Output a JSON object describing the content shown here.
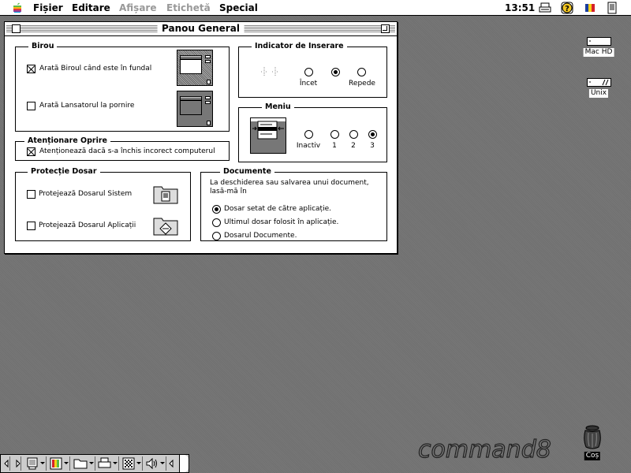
{
  "menubar": {
    "apple_icon": "apple-logo-icon",
    "items": [
      {
        "label": "Fișier",
        "enabled": true
      },
      {
        "label": "Editare",
        "enabled": true
      },
      {
        "label": "Afișare",
        "enabled": false
      },
      {
        "label": "Etichetă",
        "enabled": false
      },
      {
        "label": "Special",
        "enabled": true
      }
    ],
    "clock": "13:51",
    "status_icons": [
      "printer-icon",
      "help-icon",
      "keyboard-flag-icon",
      "application-menu-icon"
    ]
  },
  "window": {
    "title": "Panou General",
    "desktop_group": {
      "title": "Birou",
      "show_desktop_label": "Arată Biroul când este în fundal",
      "show_desktop_checked": true,
      "show_launcher_label": "Arată Lansatorul la pornire",
      "show_launcher_checked": false
    },
    "shutdown_group": {
      "title": "Atenționare Oprire",
      "warn_label": "Atenționează dacă s-a închis incorect computerul",
      "warn_checked": true
    },
    "folder_protection_group": {
      "title": "Protecție Dosar",
      "system_label": "Protejează Dosarul Sistem",
      "system_checked": false,
      "apps_label": "Protejează Dosarul Aplicații",
      "apps_checked": false
    },
    "insertion_group": {
      "title": "Indicator de Inserare",
      "options": [
        "Încet",
        "",
        "Repede"
      ],
      "selected_index": 1
    },
    "menu_group": {
      "title": "Meniu",
      "options": [
        "Inactiv",
        "1",
        "2",
        "3"
      ],
      "selected_index": 3
    },
    "documents_group": {
      "title": "Documente",
      "description": "La deschiderea sau salvarea unui document, lasă-mă în",
      "options": [
        "Dosar setat de către aplicație.",
        "Ultimul dosar folosit în aplicație.",
        "Dosarul Documente."
      ],
      "selected_index": 0
    }
  },
  "desktop": {
    "icons": [
      {
        "label": "Mac HD",
        "icon": "hard-disk-icon"
      },
      {
        "label": "Unix",
        "icon": "hard-disk-icon"
      },
      {
        "label": "Coș",
        "icon": "trash-icon"
      }
    ],
    "logo_text": "command8"
  },
  "control_strip": {
    "modules": [
      "monitor-icon",
      "color-depth-icon",
      "file-sharing-icon",
      "printer-icon",
      "appletalk-icon",
      "sound-volume-icon"
    ]
  }
}
